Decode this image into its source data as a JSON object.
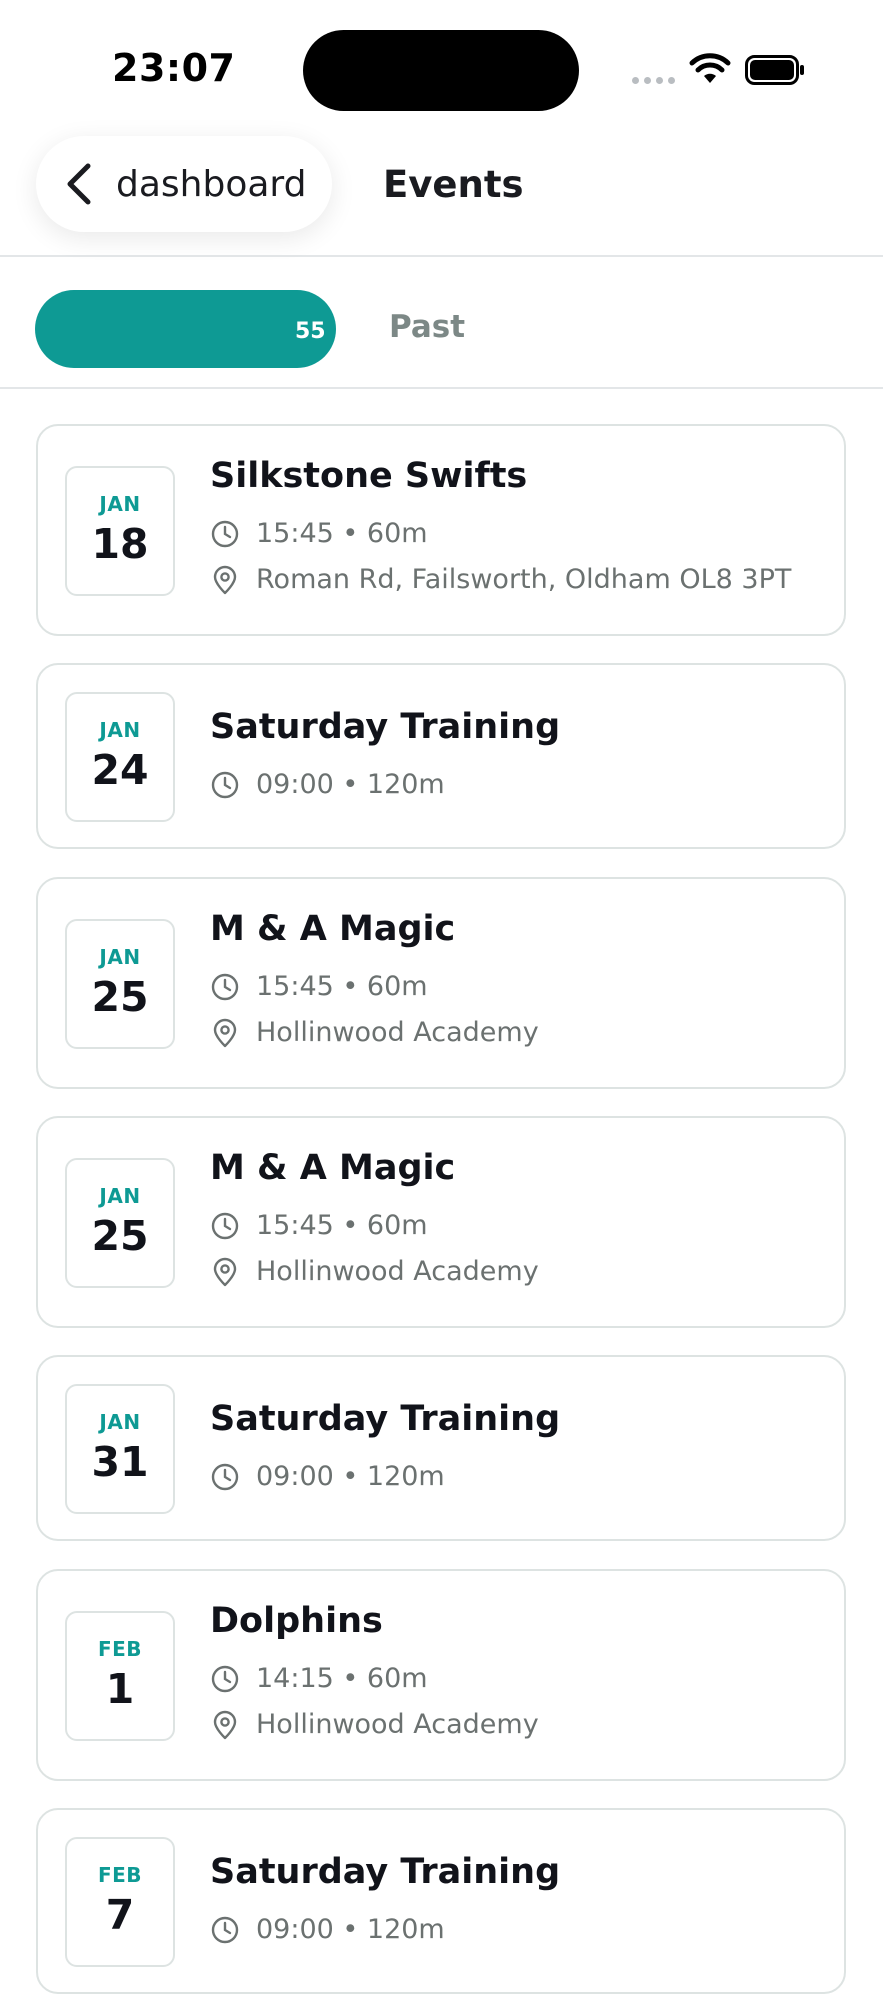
{
  "status_bar": {
    "time": "23:07"
  },
  "header": {
    "back_label": "dashboard",
    "title": "Events"
  },
  "tabs": {
    "upcoming_label": "",
    "upcoming_count": "55",
    "past_label": "Past"
  },
  "events": [
    {
      "month": "JAN",
      "day": "18",
      "title": "Silkstone Swifts",
      "time": "15:45 • 60m",
      "location": "Roman Rd, Failsworth, Oldham OL8 3PT"
    },
    {
      "month": "JAN",
      "day": "24",
      "title": "Saturday Training",
      "time": "09:00 • 120m"
    },
    {
      "month": "JAN",
      "day": "25",
      "title": "M & A Magic",
      "time": "15:45 • 60m",
      "location": "Hollinwood Academy"
    },
    {
      "month": "JAN",
      "day": "25",
      "title": "M & A Magic",
      "time": "15:45 • 60m",
      "location": "Hollinwood Academy"
    },
    {
      "month": "JAN",
      "day": "31",
      "title": "Saturday Training",
      "time": "09:00 • 120m"
    },
    {
      "month": "FEB",
      "day": "1",
      "title": "Dolphins",
      "time": "14:15 • 60m",
      "location": "Hollinwood Academy"
    },
    {
      "month": "FEB",
      "day": "7",
      "title": "Saturday Training",
      "time": "09:00 • 120m"
    }
  ],
  "colors": {
    "accent": "#0e9a94",
    "text": "#11131a",
    "muted": "#6b7170",
    "border": "#dde3e2"
  }
}
